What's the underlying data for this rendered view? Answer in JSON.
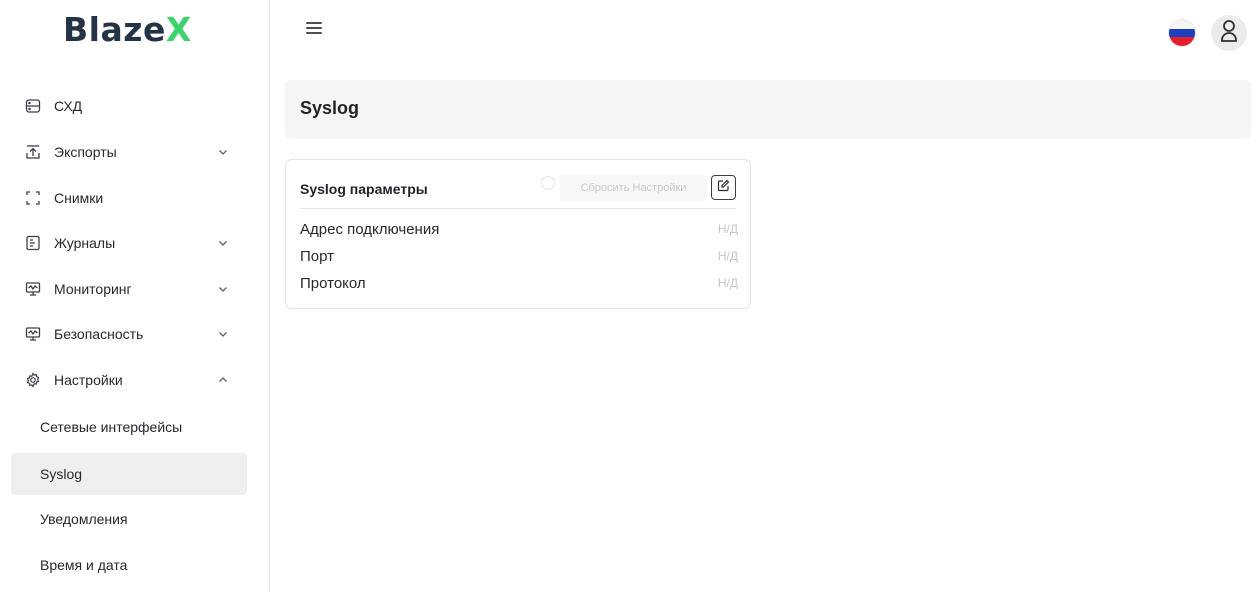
{
  "brand": {
    "name": "Blaze",
    "accent": "X",
    "accent_color": "#39d46a",
    "text_color": "#243447"
  },
  "sidebar": {
    "items": [
      {
        "label": "СХД",
        "icon": "storage-icon",
        "expandable": false
      },
      {
        "label": "Экспорты",
        "icon": "export-icon",
        "expandable": true,
        "expanded": false
      },
      {
        "label": "Снимки",
        "icon": "snapshot-icon",
        "expandable": false
      },
      {
        "label": "Журналы",
        "icon": "log-icon",
        "expandable": true,
        "expanded": false
      },
      {
        "label": "Мониторинг",
        "icon": "monitor-icon",
        "expandable": true,
        "expanded": false
      },
      {
        "label": "Безопасность",
        "icon": "security-icon",
        "expandable": true,
        "expanded": false
      },
      {
        "label": "Настройки",
        "icon": "gear-icon",
        "expandable": true,
        "expanded": true
      }
    ],
    "sub_items": [
      {
        "label": "Сетевые интерфейсы",
        "active": false
      },
      {
        "label": "Syslog",
        "active": true
      },
      {
        "label": "Уведомления",
        "active": false
      },
      {
        "label": "Время и дата",
        "active": false
      }
    ]
  },
  "header": {
    "language": "ru"
  },
  "page": {
    "title": "Syslog",
    "card": {
      "title": "Syslog параметры",
      "reset_label": "Сбросить Настройки",
      "rows": [
        {
          "label": "Адрес подключения",
          "value": "Н/Д"
        },
        {
          "label": "Порт",
          "value": "Н/Д"
        },
        {
          "label": "Протокол",
          "value": "Н/Д"
        }
      ]
    }
  }
}
